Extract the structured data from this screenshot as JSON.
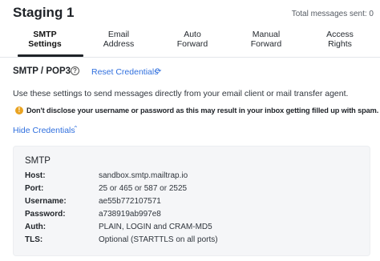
{
  "header": {
    "inbox_title": "Staging 1",
    "total_sent": "Total messages sent: 0"
  },
  "tabs": [
    {
      "line1": "SMTP",
      "line2": "Settings",
      "active": true
    },
    {
      "line1": "Email",
      "line2": "Address",
      "active": false
    },
    {
      "line1": "Auto",
      "line2": "Forward",
      "active": false
    },
    {
      "line1": "Manual",
      "line2": "Forward",
      "active": false
    },
    {
      "line1": "Access",
      "line2": "Rights",
      "active": false
    }
  ],
  "section": {
    "heading": "SMTP / POP3",
    "help_icon": "?",
    "reset_label": "Reset Credentials",
    "reset_icon": "⟳"
  },
  "description": "Use these settings to send messages directly from your email client or mail transfer agent.",
  "warning": {
    "icon": "!",
    "text": "Don't disclose your username or password as this may result in your inbox getting filled up with spam."
  },
  "hide_credentials": {
    "label": "Hide Credentials",
    "chevron": "⌃"
  },
  "credentials": {
    "title": "SMTP",
    "rows": [
      {
        "label": "Host:",
        "value": "sandbox.smtp.mailtrap.io"
      },
      {
        "label": "Port:",
        "value": "25 or 465 or 587 or 2525"
      },
      {
        "label": "Username:",
        "value": "ae55b772107571"
      },
      {
        "label": "Password:",
        "value": "a738919ab997e8"
      },
      {
        "label": "Auth:",
        "value": "PLAIN, LOGIN and CRAM-MD5"
      },
      {
        "label": "TLS:",
        "value": "Optional (STARTTLS on all ports)"
      }
    ]
  },
  "colors": {
    "link": "#2f6fde",
    "warning": "#e9a321",
    "panel_bg": "#f5f6f8"
  }
}
